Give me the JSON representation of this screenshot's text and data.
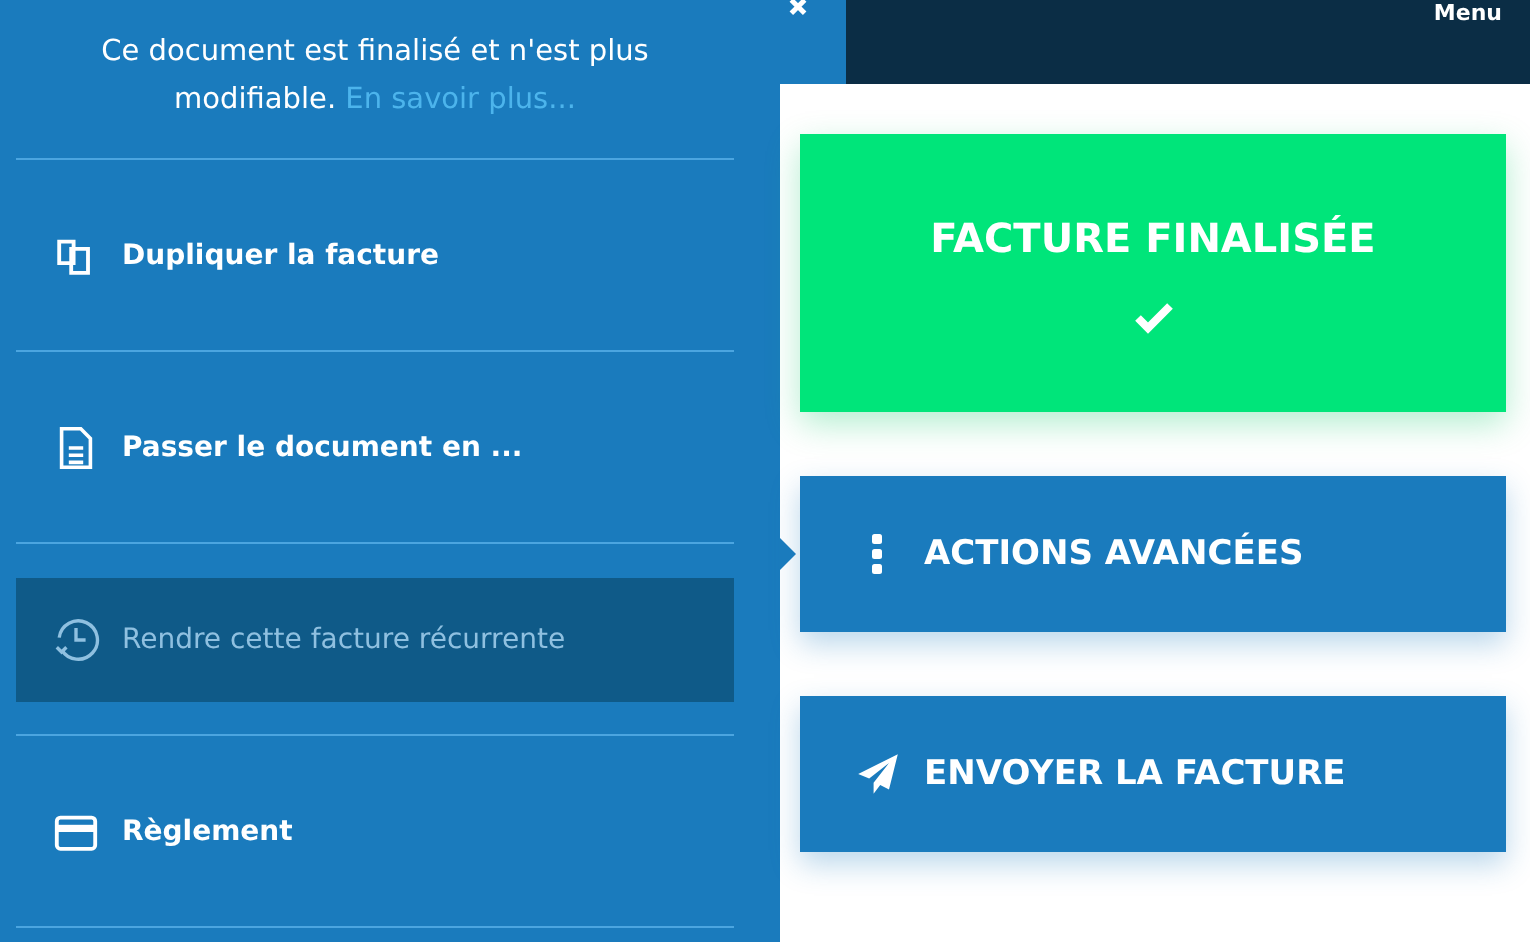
{
  "panel": {
    "notice": "Ce document est finalisé et n'est plus modifiable.",
    "notice_link": "En savoir plus...",
    "items": [
      {
        "kind": "copy",
        "label": "Dupliquer la facture",
        "disabled": false
      },
      {
        "kind": "document",
        "label": "Passer le document en ...",
        "disabled": false
      },
      {
        "kind": "history",
        "label": "Rendre cette facture récurrente",
        "disabled": true
      },
      {
        "kind": "card",
        "label": "Règlement",
        "disabled": false
      }
    ]
  },
  "top_bar": {
    "menu": "Menu"
  },
  "status_card": {
    "title": "FACTURE FINALISÉE"
  },
  "actions": [
    {
      "kind": "more",
      "label": "ACTIONS AVANCÉES",
      "pointed": true
    },
    {
      "kind": "send",
      "label": "ENVOYER LA FACTURE",
      "pointed": false
    }
  ]
}
